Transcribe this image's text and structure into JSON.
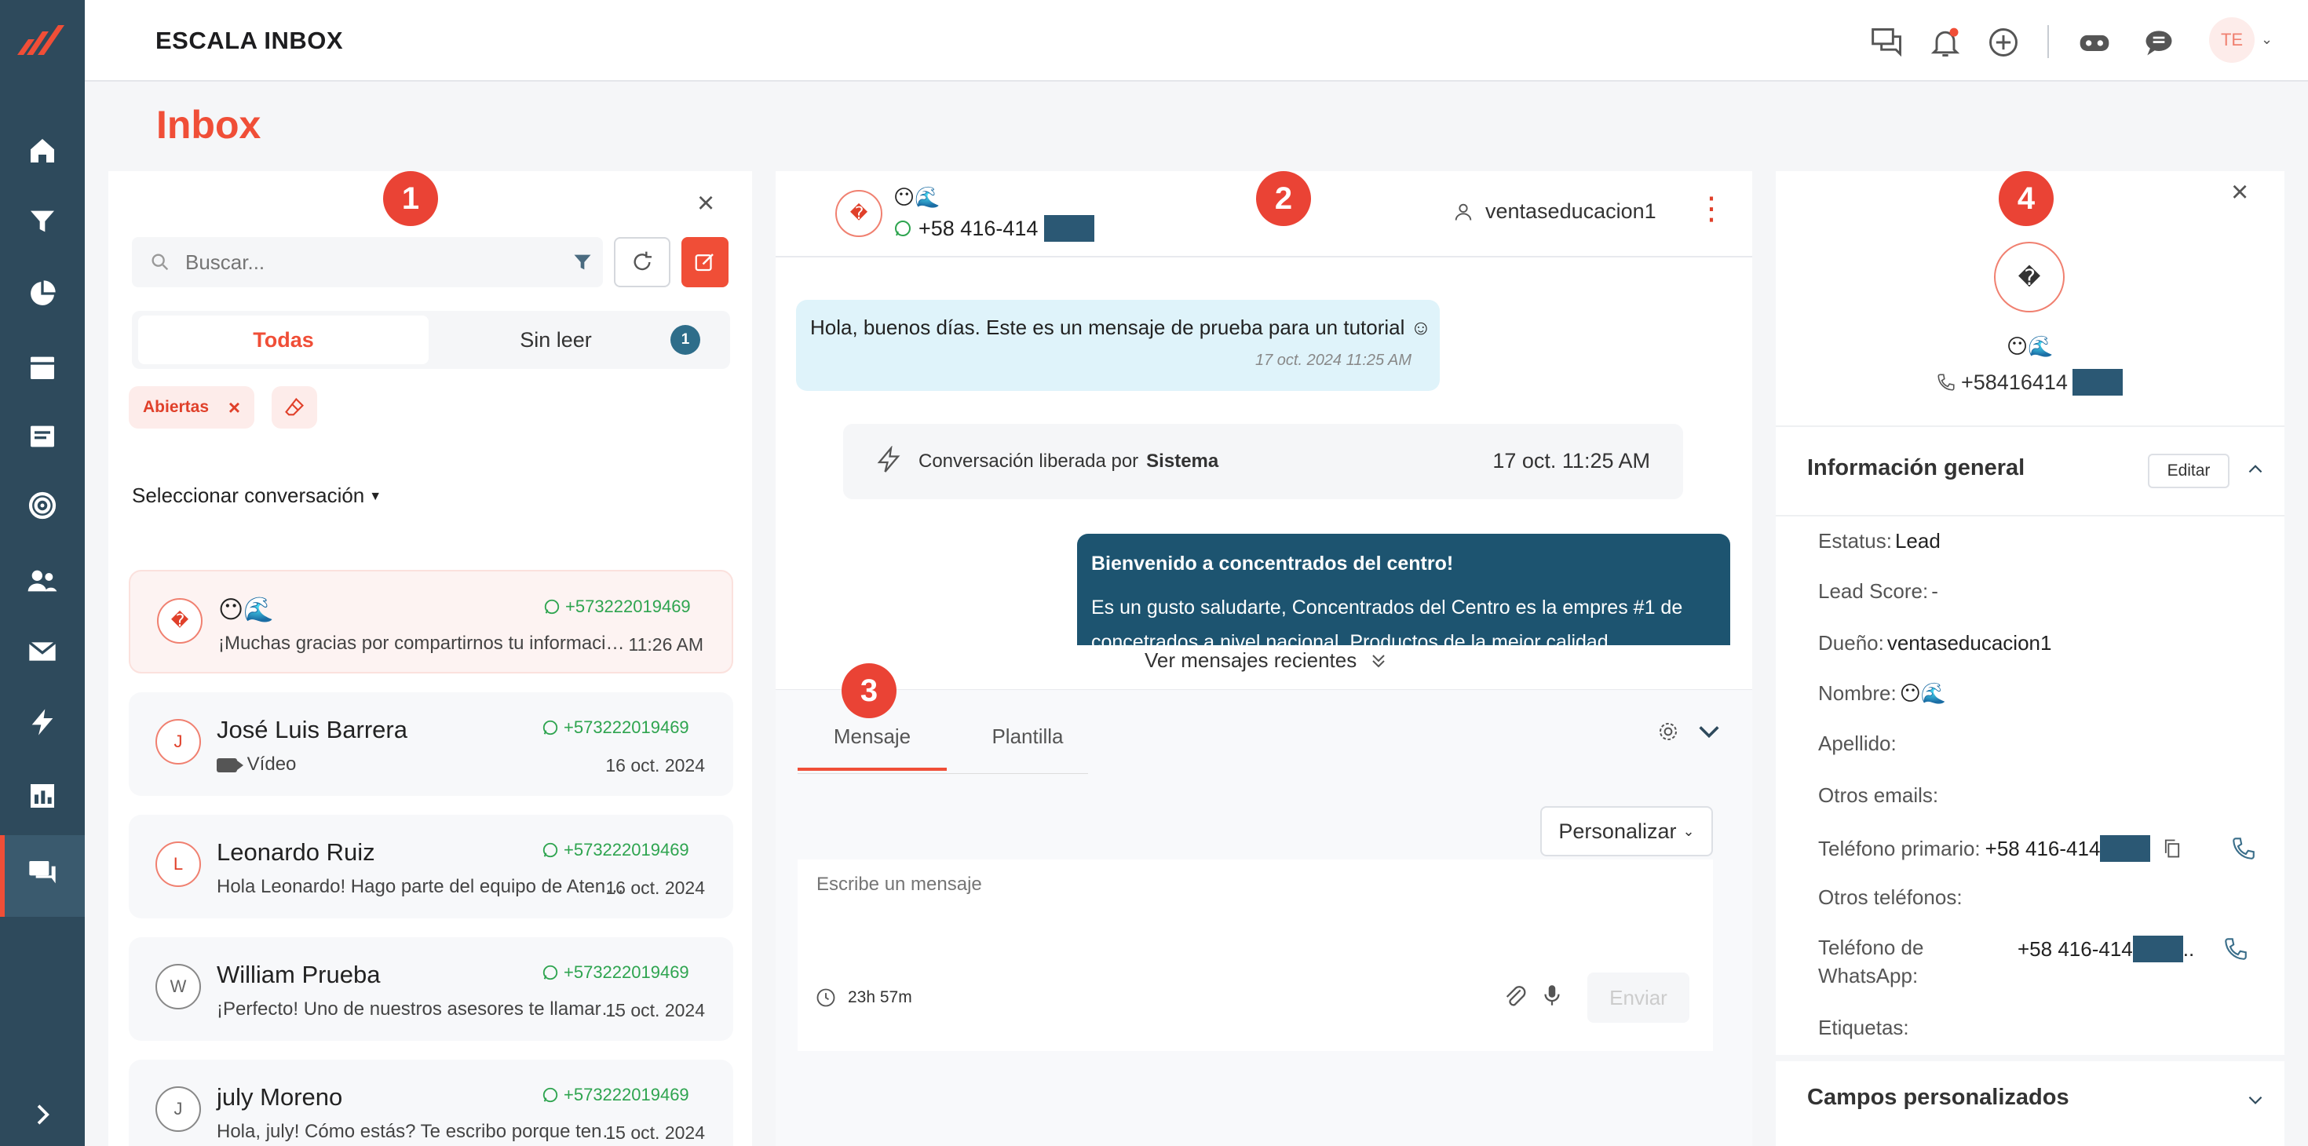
{
  "app": {
    "brand": "ESCALA INBOX",
    "page_title": "Inbox",
    "user_initials": "TE"
  },
  "colors": {
    "accent": "#f04e37",
    "nav_bg": "#2e4a5c",
    "outgoing_bubble": "#1d5470",
    "incoming_bubble": "#dff3fa",
    "whatsapp_green": "#2ea44f"
  },
  "steps": [
    "1",
    "2",
    "3",
    "4"
  ],
  "list": {
    "search_placeholder": "Buscar...",
    "tab_all": "Todas",
    "tab_unread": "Sin leer",
    "unread_count": "1",
    "filter_chip": "Abiertas",
    "select_label": "Seleccionar conversación",
    "conversations": [
      {
        "initial": "�",
        "name": "😶🌊",
        "phone": "+573222019469",
        "preview": "¡Muchas gracias por compartirnos tu información! Un asesor",
        "date": "11:26 AM"
      },
      {
        "initial": "J",
        "name": "José Luis Barrera",
        "phone": "+573222019469",
        "preview": "Vídeo",
        "date": "16 oct. 2024"
      },
      {
        "initial": "L",
        "name": "Leonardo Ruiz",
        "phone": "+573222019469",
        "preview": "Hola Leonardo! Hago parte del equipo de Atención",
        "date": "16 oct. 2024"
      },
      {
        "initial": "W",
        "name": "William Prueba",
        "phone": "+573222019469",
        "preview": "¡Perfecto! Uno de nuestros asesores te llamará pronto",
        "date": "15 oct. 2024"
      },
      {
        "initial": "J",
        "name": "july Moreno",
        "phone": "+573222019469",
        "preview": "Hola, july! Cómo estás? Te escribo porque tenemos",
        "date": "15 oct. 2024"
      }
    ]
  },
  "chat": {
    "contact_initial": "�",
    "contact_name": "😶🌊",
    "contact_phone": "+58 416-414",
    "assignee": "ventaseducacion1",
    "incoming_text": "Hola, buenos días. Este es un mensaje de prueba para un tutorial ☺",
    "incoming_time": "17 oct. 2024 11:25 AM",
    "system_text": "Conversación liberada por",
    "system_actor": "Sistema",
    "system_time": "17 oct. 11:25 AM",
    "outgoing_title": "Bienvenido a concentrados del centro!",
    "outgoing_body": "Es un gusto saludarte, Concentrados del Centro es la empres #1 de concetrados a nivel nacional. Productos de la mejor calidad",
    "recent_label": "Ver mensajes recientes"
  },
  "composer": {
    "tab_message": "Mensaje",
    "tab_template": "Plantilla",
    "personalize": "Personalizar",
    "placeholder": "Escribe un mensaje",
    "timer": "23h 57m",
    "send": "Enviar"
  },
  "contact": {
    "initial": "�",
    "name": "😶🌊",
    "phone": "+58416414",
    "section_title": "Información general",
    "edit": "Editar",
    "fields": [
      {
        "label": "Estatus:",
        "value": "Lead"
      },
      {
        "label": "Lead Score:",
        "value": "-"
      },
      {
        "label": "Dueño:",
        "value": "ventaseducacion1"
      },
      {
        "label": "Nombre:",
        "value": "😶🌊"
      },
      {
        "label": "Apellido:",
        "value": ""
      },
      {
        "label": "Otros emails:",
        "value": ""
      }
    ],
    "primary_phone_label": "Teléfono primario:",
    "primary_phone": "+58 416-414",
    "other_phones_label": "Otros teléfonos:",
    "whatsapp_label_1": "Teléfono de",
    "whatsapp_label_2": "WhatsApp:",
    "whatsapp_phone": "+58 416-414",
    "whatsapp_suffix": "..",
    "tags_label": "Etiquetas:",
    "custom_fields": "Campos personalizados"
  }
}
